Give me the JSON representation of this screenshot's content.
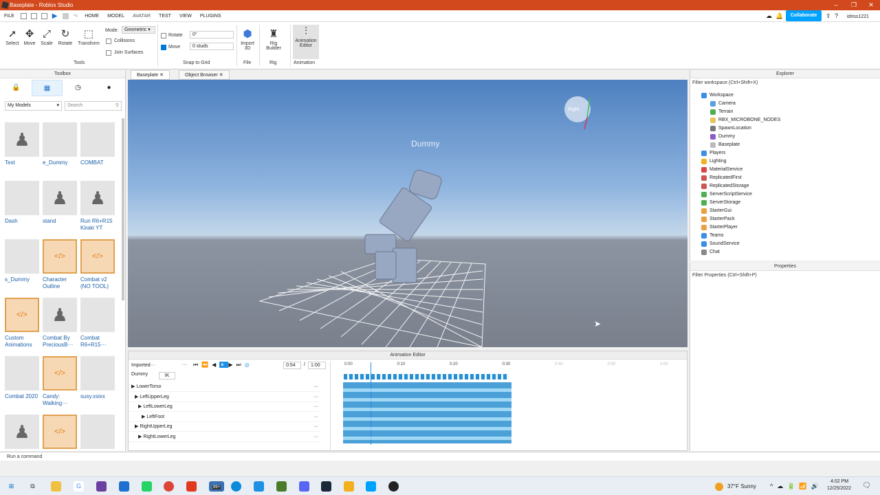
{
  "window": {
    "title": "Baseplate - Roblox Studio"
  },
  "menu": {
    "file": "FILE",
    "items": [
      "HOME",
      "MODEL",
      "AVATAR",
      "TEST",
      "VIEW",
      "PLUGINS"
    ],
    "collaborate": "Collaborate",
    "user": "idriss1221"
  },
  "ribbon": {
    "tools": [
      {
        "label": "Select",
        "icon": "cursor-icon"
      },
      {
        "label": "Move",
        "icon": "move-icon"
      },
      {
        "label": "Scale",
        "icon": "scale-icon"
      },
      {
        "label": "Rotate",
        "icon": "rotate-icon"
      },
      {
        "label": "Transform",
        "icon": "transform-icon"
      }
    ],
    "mode_label": "Mode:",
    "mode_value": "Geometric",
    "collisions": "Collisions",
    "join_surfaces": "Join Surfaces",
    "tools_group": "Tools",
    "rotate_label": "Rotate",
    "rotate_value": "0°",
    "move_label": "Move",
    "move_value": "0 studs",
    "snap_group": "Snap to Grid",
    "import3d": "Import 3D",
    "file_group": "File",
    "rig_builder": "Rig Builder",
    "rig_group": "Rig",
    "anim_editor": "Animation Editor",
    "anim_group": "Animation"
  },
  "toolbox": {
    "title": "Toolbox",
    "dropdown": "My Models",
    "search_placeholder": "Search",
    "models": [
      {
        "name": "Test",
        "icon": "robot"
      },
      {
        "name": "e_Dummy",
        "icon": ""
      },
      {
        "name": "COMBAT",
        "icon": ""
      },
      {
        "name": "Dash",
        "icon": ""
      },
      {
        "name": "stand",
        "icon": "robot"
      },
      {
        "name": "Run R6+R15 Kiraki YT",
        "icon": "robot"
      },
      {
        "name": "s_Dummy",
        "icon": ""
      },
      {
        "name": "Character Outline",
        "icon": "script"
      },
      {
        "name": "Combat v2 (NO TOOL)",
        "icon": "script"
      },
      {
        "name": "Custom Animations",
        "icon": "script"
      },
      {
        "name": "Combat By PreciousB···",
        "icon": "robot"
      },
      {
        "name": "Combat R6+R15···",
        "icon": ""
      },
      {
        "name": "Combat 2020",
        "icon": ""
      },
      {
        "name": "Candy: Walking···",
        "icon": "script"
      },
      {
        "name": "susy.xsixx",
        "icon": ""
      },
      {
        "name": "",
        "icon": "robot"
      },
      {
        "name": "",
        "icon": "script"
      },
      {
        "name": "",
        "icon": ""
      }
    ]
  },
  "doc_tabs": [
    "Baseplate",
    "Object Browser"
  ],
  "viewport": {
    "dummy_label": "Dummy",
    "view_cube": "Right"
  },
  "anim": {
    "title": "Animation Editor",
    "anim_name": "Imported···",
    "time": "0:54",
    "total": "1:00",
    "rig": "Dummy",
    "ik": "IK",
    "ticks": [
      "0:00",
      "0:10",
      "0:20",
      "0:30",
      "0:40",
      "0:50",
      "1:00"
    ],
    "tracks": [
      "LowerTorso",
      "LeftUpperLeg",
      "LeftLowerLeg",
      "LeftFoot",
      "RightUpperLeg",
      "RightLowerLeg"
    ]
  },
  "explorer": {
    "title": "Explorer",
    "filter": "Filter workspace (Ctrl+Shift+X)",
    "items": [
      {
        "label": "Workspace",
        "color": "#3a8ee6"
      },
      {
        "label": "Camera",
        "color": "#5aa0e0"
      },
      {
        "label": "Terrain",
        "color": "#4caf50"
      },
      {
        "label": "RBX_MICROBONE_NODES",
        "color": "#e8c45a"
      },
      {
        "label": "SpawnLocation",
        "color": "#777"
      },
      {
        "label": "Dummy",
        "color": "#8a5cc7"
      },
      {
        "label": "Baseplate",
        "color": "#bbb"
      },
      {
        "label": "Players",
        "color": "#3a8ee6"
      },
      {
        "label": "Lighting",
        "color": "#f2b01e"
      },
      {
        "label": "MaterialService",
        "color": "#d44"
      },
      {
        "label": "ReplicatedFirst",
        "color": "#c55"
      },
      {
        "label": "ReplicatedStorage",
        "color": "#c55"
      },
      {
        "label": "ServerScriptService",
        "color": "#4caf50"
      },
      {
        "label": "ServerStorage",
        "color": "#4caf50"
      },
      {
        "label": "StarterGui",
        "color": "#e8a040"
      },
      {
        "label": "StarterPack",
        "color": "#e8a040"
      },
      {
        "label": "StarterPlayer",
        "color": "#e8a040"
      },
      {
        "label": "Teams",
        "color": "#3a8ee6"
      },
      {
        "label": "SoundService",
        "color": "#3a8ee6"
      },
      {
        "label": "Chat",
        "color": "#888"
      }
    ]
  },
  "properties": {
    "title": "Properties",
    "filter": "Filter Properties (Ctrl+Shift+P)"
  },
  "command": {
    "placeholder": "Run a command"
  },
  "taskbar": {
    "weather": "37°F  Sunny",
    "time": "4:02 PM",
    "date": "12/25/2022",
    "badge": "99+"
  }
}
